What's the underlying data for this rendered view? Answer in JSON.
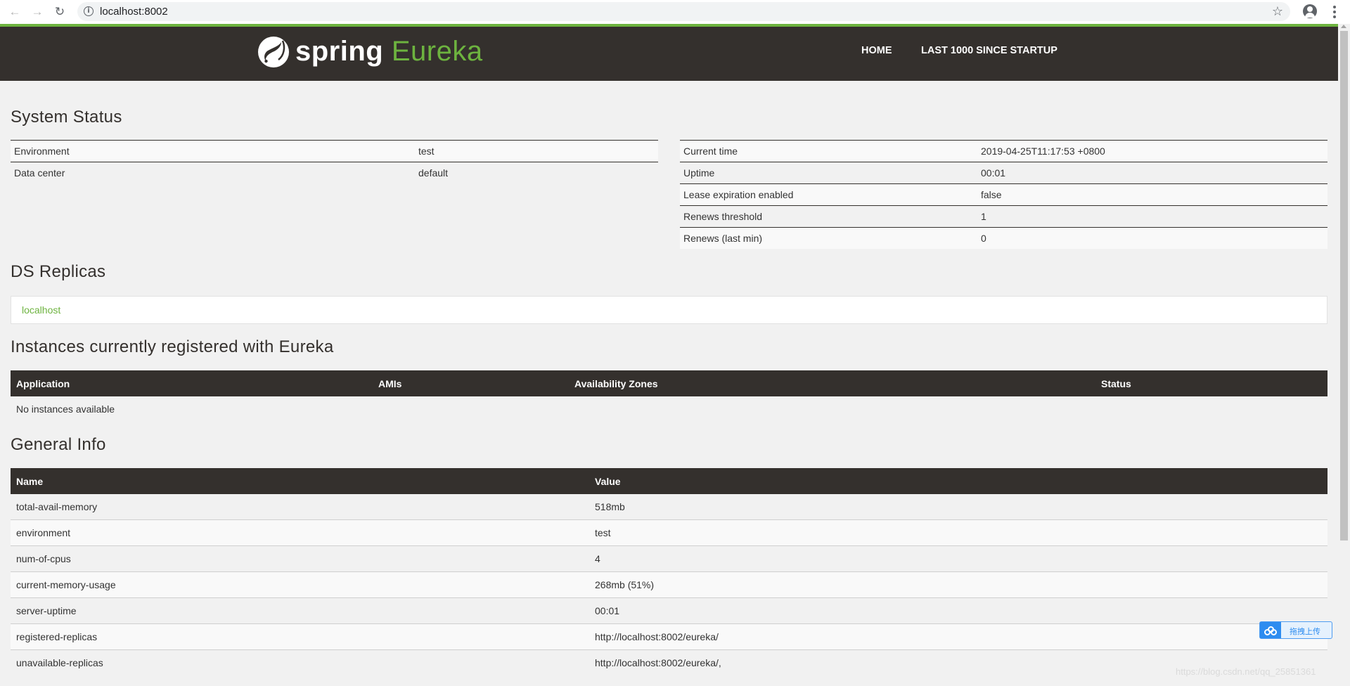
{
  "browser": {
    "url": "localhost:8002",
    "back_glyph": "←",
    "forward_glyph": "→",
    "reload_glyph": "↻",
    "info_glyph": "i",
    "star_glyph": "☆"
  },
  "header": {
    "logo_spring": "spring",
    "logo_eureka": "Eureka",
    "nav": [
      "HOME",
      "LAST 1000 SINCE STARTUP"
    ],
    "accent_color": "#6db33f",
    "bg_color": "#34302d"
  },
  "system_status": {
    "title": "System Status",
    "left": [
      {
        "key": "Environment",
        "value": "test"
      },
      {
        "key": "Data center",
        "value": "default"
      }
    ],
    "right": [
      {
        "key": "Current time",
        "value": "2019-04-25T11:17:53 +0800"
      },
      {
        "key": "Uptime",
        "value": "00:01"
      },
      {
        "key": "Lease expiration enabled",
        "value": "false"
      },
      {
        "key": "Renews threshold",
        "value": "1"
      },
      {
        "key": "Renews (last min)",
        "value": "0"
      }
    ]
  },
  "ds_replicas": {
    "title": "DS Replicas",
    "items": [
      "localhost"
    ]
  },
  "instances": {
    "title": "Instances currently registered with Eureka",
    "columns": [
      "Application",
      "AMIs",
      "Availability Zones",
      "Status"
    ],
    "empty_text": "No instances available"
  },
  "general_info": {
    "title": "General Info",
    "columns": [
      "Name",
      "Value"
    ],
    "rows": [
      {
        "name": "total-avail-memory",
        "value": "518mb"
      },
      {
        "name": "environment",
        "value": "test"
      },
      {
        "name": "num-of-cpus",
        "value": "4"
      },
      {
        "name": "current-memory-usage",
        "value": "268mb (51%)"
      },
      {
        "name": "server-uptime",
        "value": "00:01"
      },
      {
        "name": "registered-replicas",
        "value": "http://localhost:8002/eureka/"
      },
      {
        "name": "unavailable-replicas",
        "value": "http://localhost:8002/eureka/,"
      }
    ]
  },
  "overlay": {
    "upload_label": "拖拽上传",
    "watermark": "https://blog.csdn.net/qq_25851361"
  }
}
